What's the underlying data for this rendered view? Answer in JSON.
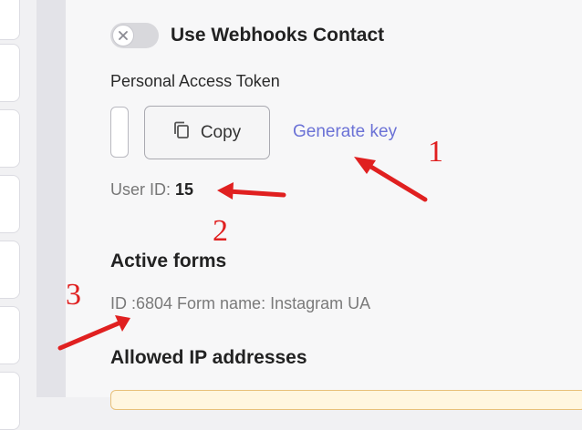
{
  "webhooks": {
    "toggle_label": "Use Webhooks Contact",
    "enabled": false
  },
  "token": {
    "label": "Personal Access Token",
    "value": "",
    "copy_label": "Copy",
    "generate_label": "Generate key"
  },
  "user": {
    "id_label": "User ID:",
    "id_value": "15"
  },
  "active_forms": {
    "heading": "Active forms",
    "line": "ID :6804 Form name: Instagram UA"
  },
  "allowed_ip": {
    "heading": "Allowed IP addresses"
  },
  "annotations": {
    "n1": "1",
    "n2": "2",
    "n3": "3",
    "color": "#e02020"
  },
  "colors": {
    "link": "#6b72d6",
    "panel_bg": "#f7f7f8",
    "warning_border": "#e8c07a"
  }
}
